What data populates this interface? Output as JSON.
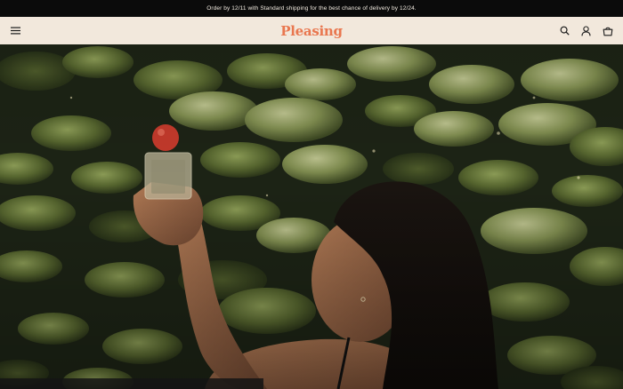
{
  "announcement": {
    "text": "Order by 12/11 with Standard shipping for the best chance of delivery by 12/24."
  },
  "header": {
    "brand": "Pleasing",
    "menu_icon": "hamburger-menu-icon",
    "search_icon": "search-icon",
    "account_icon": "user-icon",
    "cart_icon": "shopping-bag-icon",
    "brand_color": "#e9774f",
    "background_color": "#f2e8dc"
  },
  "hero": {
    "image_subject": "woman in pond holding perfume bottle among lily pads",
    "bottle_cap_color": "#c0392b"
  }
}
